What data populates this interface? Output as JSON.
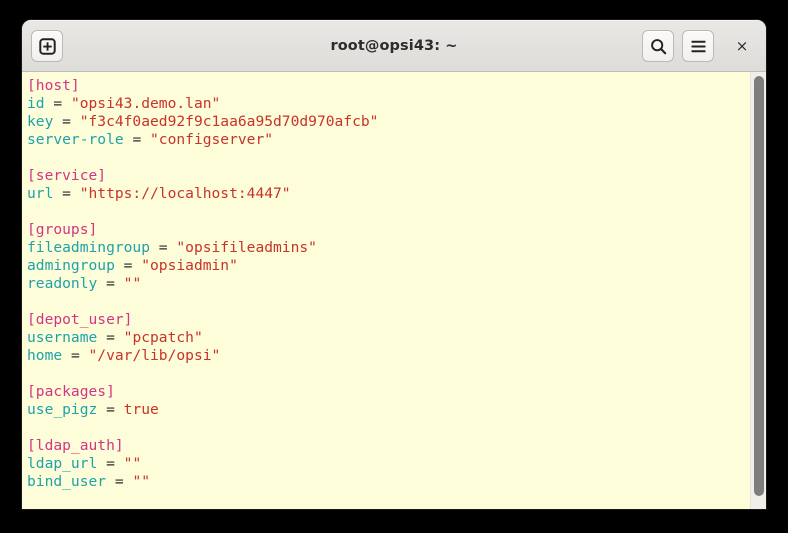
{
  "window": {
    "title": "root@opsi43: ~",
    "titlebar": {
      "new_tab_button": {
        "label": "",
        "icon": "new-tab-plus-icon",
        "tooltip": "New Tab"
      },
      "search_button": {
        "label": "",
        "icon": "search-icon",
        "tooltip": "Find"
      },
      "menu_button": {
        "label": "",
        "icon": "hamburger-menu-icon",
        "tooltip": "Menu"
      },
      "close_button": {
        "label": "×",
        "icon": "close-icon",
        "tooltip": "Close"
      }
    }
  },
  "colors": {
    "desktop_background": "#000000",
    "titlebar_background": "#e4e2df",
    "terminal_background": "#fdfdda",
    "section_header": "#d33682",
    "key_name": "#1fa2a8",
    "string_value": "#c8332a",
    "punctuation": "#2b2b2b",
    "scrollbar_thumb": "#7e7e7e"
  },
  "terminal": {
    "scrollbar": {
      "thumb_top_percent": 0,
      "thumb_height_percent": 98
    },
    "lines": [
      {
        "type": "section",
        "text": "[host]"
      },
      {
        "type": "pair",
        "key": "id",
        "value": "\"opsi43.demo.lan\"",
        "value_kind": "string"
      },
      {
        "type": "pair",
        "key": "key",
        "value": "\"f3c4f0aed92f9c1aa6a95d70d970afcb\"",
        "value_kind": "string"
      },
      {
        "type": "pair",
        "key": "server-role",
        "value": "\"configserver\"",
        "value_kind": "string"
      },
      {
        "type": "blank",
        "text": ""
      },
      {
        "type": "section",
        "text": "[service]"
      },
      {
        "type": "pair",
        "key": "url",
        "value": "\"https://localhost:4447\"",
        "value_kind": "string"
      },
      {
        "type": "blank",
        "text": ""
      },
      {
        "type": "section",
        "text": "[groups]"
      },
      {
        "type": "pair",
        "key": "fileadmingroup",
        "value": "\"opsifileadmins\"",
        "value_kind": "string"
      },
      {
        "type": "pair",
        "key": "admingroup",
        "value": "\"opsiadmin\"",
        "value_kind": "string"
      },
      {
        "type": "pair",
        "key": "readonly",
        "value": "\"\"",
        "value_kind": "string"
      },
      {
        "type": "blank",
        "text": ""
      },
      {
        "type": "section",
        "text": "[depot_user]"
      },
      {
        "type": "pair",
        "key": "username",
        "value": "\"pcpatch\"",
        "value_kind": "string"
      },
      {
        "type": "pair",
        "key": "home",
        "value": "\"/var/lib/opsi\"",
        "value_kind": "string"
      },
      {
        "type": "blank",
        "text": ""
      },
      {
        "type": "section",
        "text": "[packages]"
      },
      {
        "type": "pair",
        "key": "use_pigz",
        "value": "true",
        "value_kind": "bool"
      },
      {
        "type": "blank",
        "text": ""
      },
      {
        "type": "section",
        "text": "[ldap_auth]"
      },
      {
        "type": "pair",
        "key": "ldap_url",
        "value": "\"\"",
        "value_kind": "string"
      },
      {
        "type": "pair",
        "key": "bind_user",
        "value": "\"\"",
        "value_kind": "string"
      }
    ]
  }
}
